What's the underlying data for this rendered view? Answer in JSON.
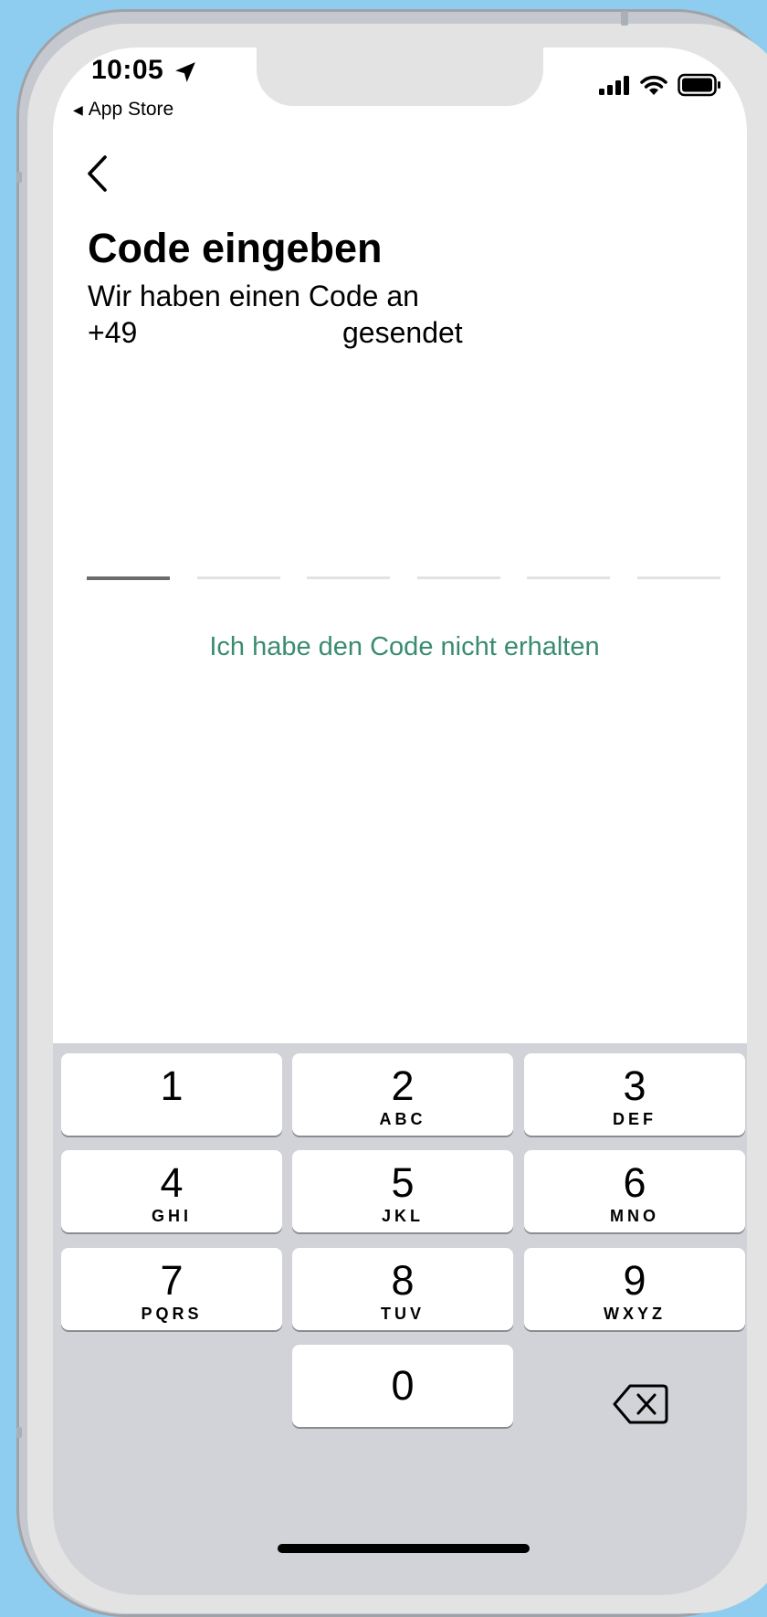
{
  "status_bar": {
    "time": "10:05",
    "back_app": "App Store",
    "location_icon": "location-arrow-icon",
    "signal_icon": "cellular-signal-icon",
    "wifi_icon": "wifi-icon",
    "battery_icon": "battery-icon"
  },
  "nav": {
    "back_icon": "chevron-left-icon"
  },
  "header": {
    "title": "Code eingeben",
    "subtitle_line1": "Wir haben einen Code an",
    "phone_prefix": "+49",
    "subtitle_suffix": "gesendet"
  },
  "code_input": {
    "length": 6,
    "active_index": 0
  },
  "resend_link": "Ich habe den Code nicht erhalten",
  "colors": {
    "accent": "#3a8c71",
    "keyboard_bg": "#d1d3d9",
    "background": "#8fcdf0"
  },
  "keypad": {
    "keys": [
      {
        "digit": "1",
        "letters": ""
      },
      {
        "digit": "2",
        "letters": "ABC"
      },
      {
        "digit": "3",
        "letters": "DEF"
      },
      {
        "digit": "4",
        "letters": "GHI"
      },
      {
        "digit": "5",
        "letters": "JKL"
      },
      {
        "digit": "6",
        "letters": "MNO"
      },
      {
        "digit": "7",
        "letters": "PQRS"
      },
      {
        "digit": "8",
        "letters": "TUV"
      },
      {
        "digit": "9",
        "letters": "WXYZ"
      },
      {
        "digit": "0",
        "letters": ""
      }
    ],
    "delete_icon": "backspace-icon"
  }
}
